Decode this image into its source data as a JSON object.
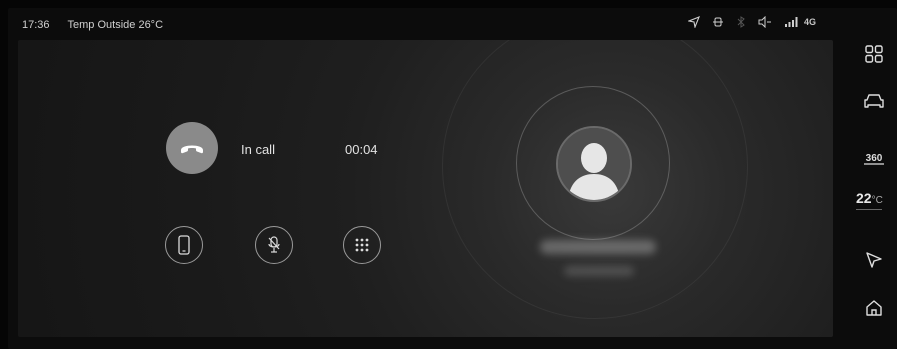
{
  "statusbar": {
    "time": "17:36",
    "outside_temp": "Temp Outside 26°C",
    "network": "4G",
    "icons": [
      "navigation-arrow-icon",
      "bluetooth-device-icon",
      "bluetooth-icon",
      "volume-icon",
      "signal-bars-icon"
    ]
  },
  "call": {
    "status": "In call",
    "timer": "00:04",
    "hangup_icon": "phone-hangup-icon",
    "controls": [
      "handset-icon",
      "mute-mic-icon",
      "keypad-icon"
    ]
  },
  "sidebar": {
    "temperature_value": "22",
    "temperature_unit": "°C",
    "view_360_label": "360",
    "items": [
      "apps-grid-icon",
      "car-icon",
      "camera-360-icon",
      "climate-temp",
      "navigation-icon",
      "home-icon"
    ]
  },
  "colors": {
    "background": "#050505",
    "panel": "#1f1f1f",
    "hangup_button": "#8a8a8a",
    "text": "#e2e2e2"
  }
}
